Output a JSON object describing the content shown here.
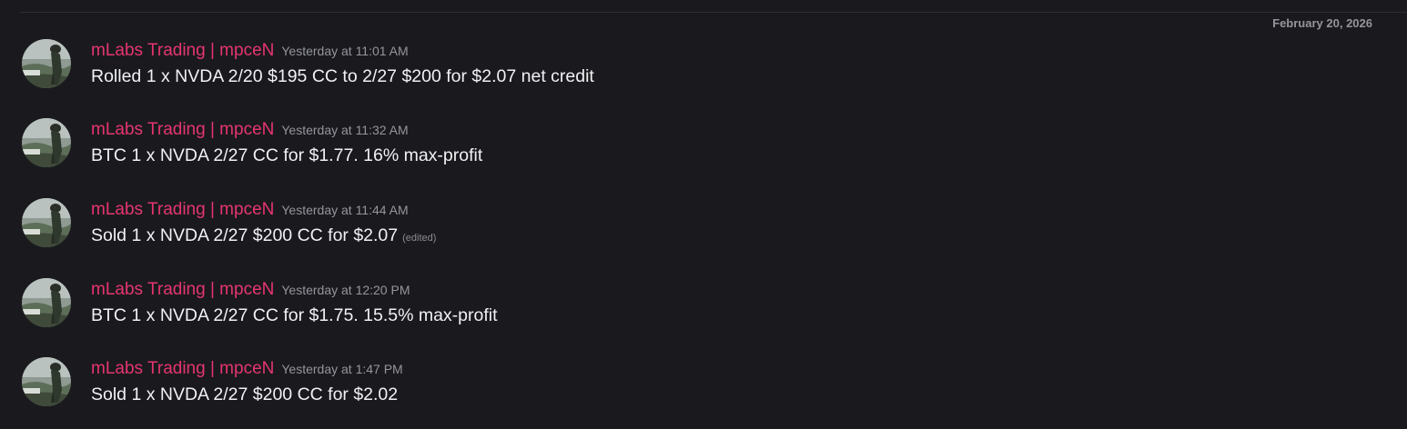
{
  "date_divider": "February 20, 2026",
  "colors": {
    "background": "#1a1a1e",
    "username": "#e6356f",
    "timestamp": "#94959c",
    "message_text": "#f0f1f3",
    "divider": "#2e2f35"
  },
  "messages": [
    {
      "author": "mLabs Trading | mpceN",
      "timestamp": "Yesterday at 11:01 AM",
      "text": "Rolled 1 x NVDA 2/20 $195 CC to 2/27 $200 for $2.07 net credit",
      "edited": ""
    },
    {
      "author": "mLabs Trading | mpceN",
      "timestamp": "Yesterday at 11:32 AM",
      "text": "BTC 1 x NVDA 2/27 CC for $1.77. 16% max-profit",
      "edited": ""
    },
    {
      "author": "mLabs Trading | mpceN",
      "timestamp": "Yesterday at 11:44 AM",
      "text": "Sold 1 x NVDA 2/27 $200 CC for $2.07",
      "edited": "(edited)"
    },
    {
      "author": "mLabs Trading | mpceN",
      "timestamp": "Yesterday at 12:20 PM",
      "text": "BTC 1 x NVDA 2/27 CC for $1.75. 15.5% max-profit",
      "edited": ""
    },
    {
      "author": "mLabs Trading | mpceN",
      "timestamp": "Yesterday at 1:47 PM",
      "text": "Sold 1 x NVDA 2/27 $200 CC for $2.02",
      "edited": ""
    }
  ]
}
